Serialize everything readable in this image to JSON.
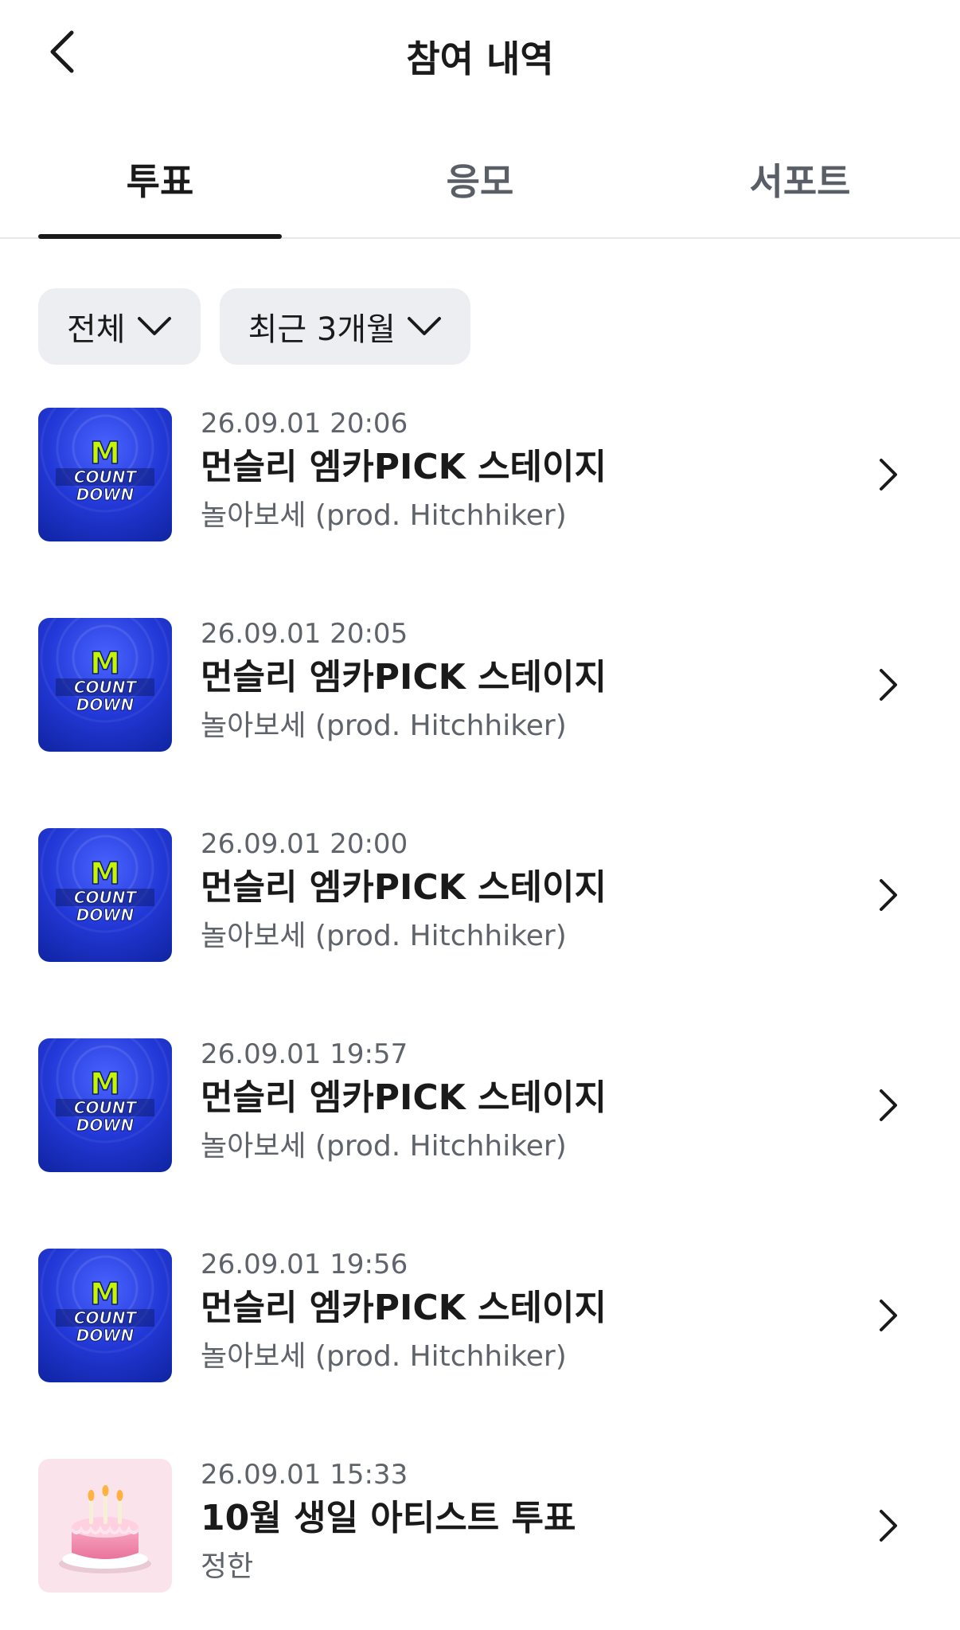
{
  "header": {
    "title": "참여 내역",
    "back_icon": "chevron-left-icon"
  },
  "tabs": [
    {
      "label": "투표",
      "active": true
    },
    {
      "label": "응모",
      "active": false
    },
    {
      "label": "서포트",
      "active": false
    }
  ],
  "filters": [
    {
      "label": "전체",
      "icon": "chevron-down-icon"
    },
    {
      "label": "최근 3개월",
      "icon": "chevron-down-icon"
    }
  ],
  "items": [
    {
      "date": "26.09.01 20:06",
      "title": "먼슬리 엠카PICK 스테이지",
      "subtitle": "놀아보세 (prod. Hitchhiker)",
      "thumb": "mcountdown-logo"
    },
    {
      "date": "26.09.01 20:05",
      "title": "먼슬리 엠카PICK 스테이지",
      "subtitle": "놀아보세 (prod. Hitchhiker)",
      "thumb": "mcountdown-logo"
    },
    {
      "date": "26.09.01 20:00",
      "title": "먼슬리 엠카PICK 스테이지",
      "subtitle": "놀아보세 (prod. Hitchhiker)",
      "thumb": "mcountdown-logo"
    },
    {
      "date": "26.09.01 19:57",
      "title": "먼슬리 엠카PICK 스테이지",
      "subtitle": "놀아보세 (prod. Hitchhiker)",
      "thumb": "mcountdown-logo"
    },
    {
      "date": "26.09.01 19:56",
      "title": "먼슬리 엠카PICK 스테이지",
      "subtitle": "놀아보세 (prod. Hitchhiker)",
      "thumb": "mcountdown-logo"
    },
    {
      "date": "26.09.01 15:33",
      "title": "10월 생일 아티스트 투표",
      "subtitle": "정한",
      "thumb": "birthday-cake"
    }
  ],
  "logo_text": {
    "m": "M",
    "line1": "COUNT",
    "line2": "DOWN"
  },
  "colors": {
    "text_primary": "#1a1a1a",
    "text_secondary": "#5f636b",
    "chip_bg": "#eceef1",
    "mcountdown_blue": "#1c33c9",
    "logo_green": "#c6f500",
    "cake_bg": "#fbe3ec"
  }
}
